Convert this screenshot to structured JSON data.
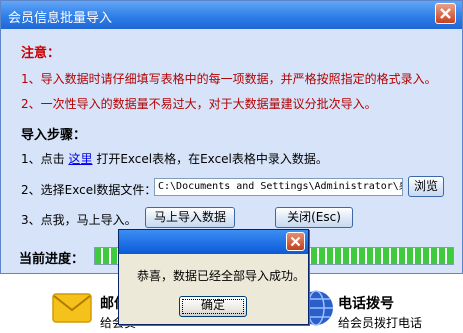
{
  "window": {
    "title": "会员信息批量导入"
  },
  "notice": {
    "heading": "注意：",
    "items": [
      "1、导入数据时请仔细填写表格中的每一项数据，并严格按照指定的格式录入。",
      "2、一次性导入的数据量不易过大，对于大数据量建议分批次导入。"
    ]
  },
  "steps": {
    "heading": "导入步骤：",
    "step1_prefix": "1、点击",
    "step1_link": "这里",
    "step1_suffix": "打开Excel表格，在Excel表格中录入数据。",
    "step2_label": "2、选择Excel数据文件：",
    "file_path": "C:\\Documents and Settings\\Administrator\\桌面",
    "browse_label": "浏览",
    "step3_label": "3、点我，马上导入。",
    "import_label": "马上导入数据",
    "close_label": "关闭(Esc)"
  },
  "progress": {
    "label": "当前进度：",
    "value": 1.0
  },
  "bottom": {
    "mail_title": "邮件",
    "mail_sub": "给会员",
    "phone_title": "电话拨号",
    "phone_sub": "给会员拨打电话"
  },
  "dialog": {
    "message": "恭喜，数据已经全部导入成功。",
    "ok_label": "确定"
  },
  "icons": {
    "window_close": "close-icon",
    "dialog_close": "close-icon",
    "mail": "envelope-icon",
    "phone": "globe-phone-icon"
  },
  "colors": {
    "titlebar": "#2f7fe8",
    "client_bg": "#d6e3f8",
    "accent_red": "#c80000",
    "progress": "#3ecb3e"
  }
}
